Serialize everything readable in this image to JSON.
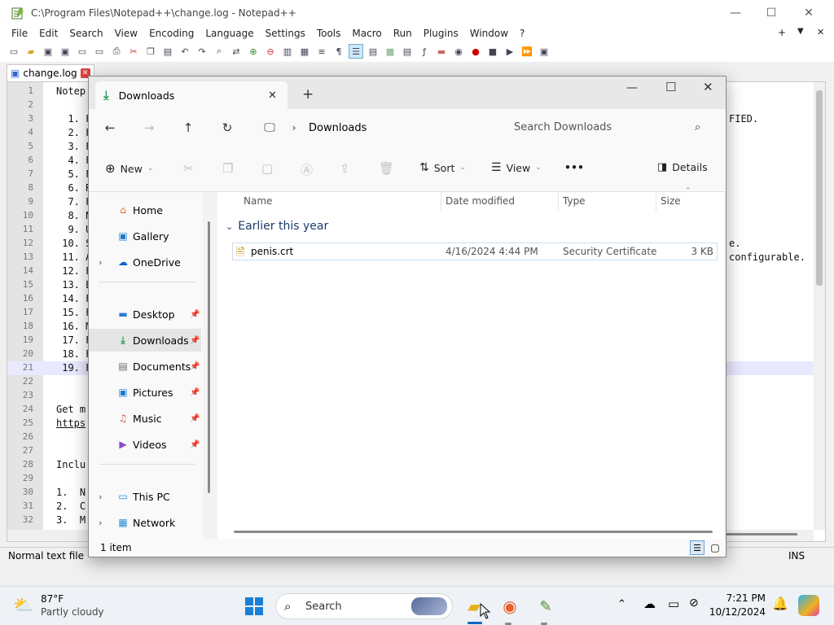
{
  "npp": {
    "title": "C:\\Program Files\\Notepad++\\change.log - Notepad++",
    "menu": [
      "File",
      "Edit",
      "Search",
      "View",
      "Encoding",
      "Language",
      "Settings",
      "Tools",
      "Macro",
      "Run",
      "Plugins",
      "Window",
      "?"
    ],
    "menu_right": [
      "+",
      "▼",
      "✕"
    ],
    "tab": "change.log",
    "line_numbers": [
      "1",
      "2",
      "3",
      "4",
      "5",
      "6",
      "7",
      "8",
      "9",
      "10",
      "11",
      "12",
      "13",
      "14",
      "15",
      "16",
      "17",
      "18",
      "19",
      "20",
      "21",
      "22",
      "23",
      "24",
      "25",
      "26",
      "27",
      "28",
      "29",
      "30",
      "31",
      "32"
    ],
    "lines": {
      "l1": "Notep",
      "l3": "  1. F",
      "l4": "  2. F",
      "l5": "  3. F",
      "l6": "  4. F",
      "l7": "  5. F",
      "l8": "  6. R",
      "l9": "  7. F",
      "l10": "  8. N",
      "l11": "  9. U",
      "l12": " 10. S",
      "l13": " 11. A",
      "l14": " 12. F",
      "l15": " 13. E",
      "l16": " 14. F",
      "l17": " 15. F",
      "l18": " 16. M",
      "l19": " 17. F",
      "l20": " 18. F",
      "l21": " 19. F",
      "l24": "Get m",
      "l25": "https",
      "l28": "Inclu",
      "l30": "1.  N",
      "l31": "2.  C",
      "l32": "3.  M"
    },
    "right_fragments": {
      "r3": "FIED.",
      "r12": "e.",
      "r13": "configurable."
    },
    "status_left": "Normal text file",
    "status_ins": "INS"
  },
  "explorer": {
    "tab_title": "Downloads",
    "breadcrumb": "Downloads",
    "search_placeholder": "Search Downloads",
    "new_label": "New",
    "sort_label": "Sort",
    "view_label": "View",
    "more_label": "•••",
    "details_label": "Details",
    "sidebar": {
      "home": "Home",
      "gallery": "Gallery",
      "onedrive": "OneDrive",
      "desktop": "Desktop",
      "downloads": "Downloads",
      "documents": "Documents",
      "pictures": "Pictures",
      "music": "Music",
      "videos": "Videos",
      "thispc": "This PC",
      "network": "Network"
    },
    "columns": {
      "name": "Name",
      "date": "Date modified",
      "type": "Type",
      "size": "Size"
    },
    "group": "Earlier this year",
    "files": [
      {
        "name": "penis.crt",
        "date": "4/16/2024 4:44 PM",
        "type": "Security Certificate",
        "size": "3 KB"
      }
    ],
    "status": "1 item"
  },
  "taskbar": {
    "temp": "87°F",
    "weather": "Partly cloudy",
    "search": "Search",
    "time": "7:21 PM",
    "date": "10/12/2024"
  },
  "colors": {
    "accent": "#0067c0",
    "selection": "#cce8ff",
    "hover": "#e5e5e5"
  }
}
